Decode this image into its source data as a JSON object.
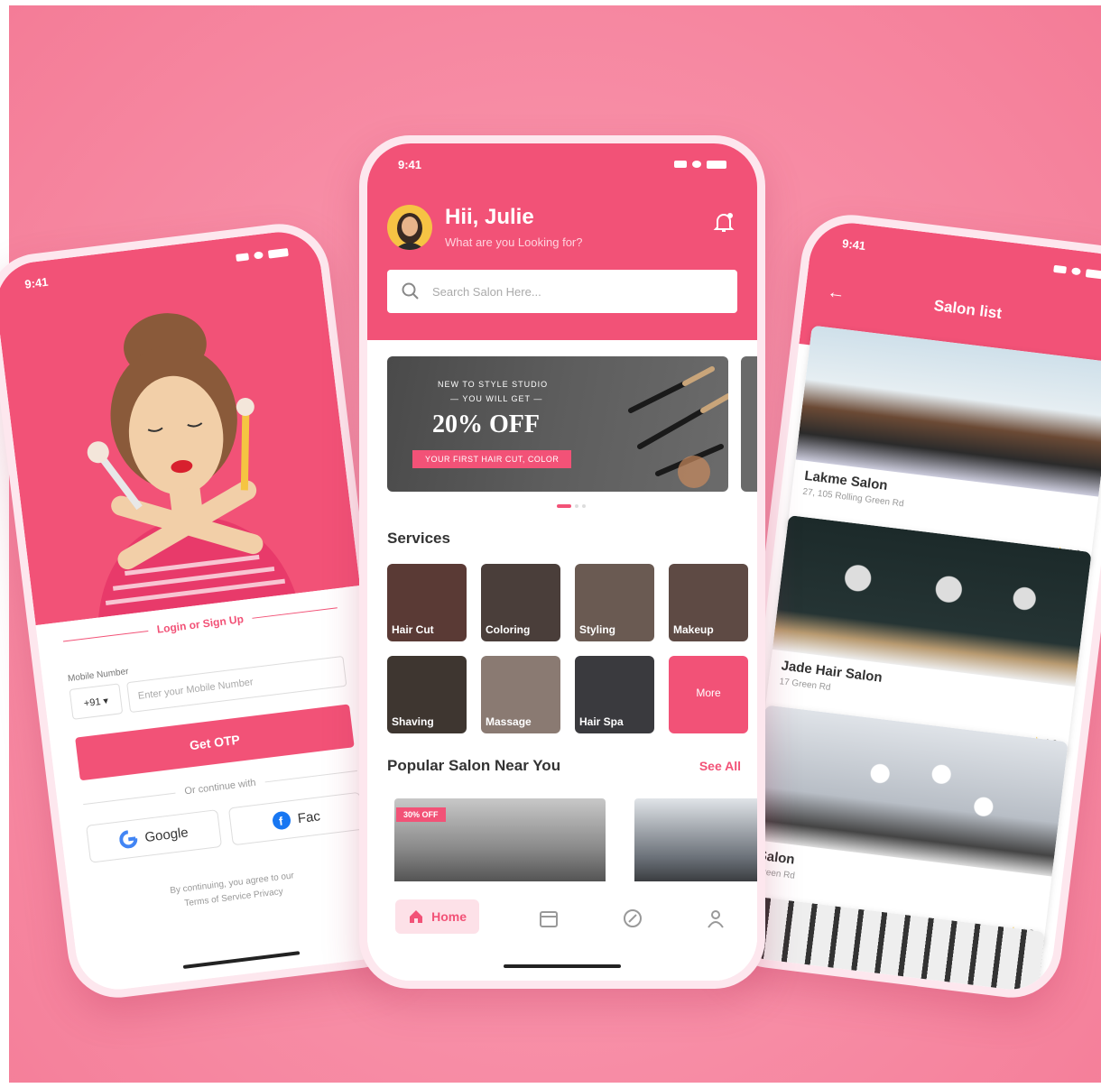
{
  "colors": {
    "accent": "#f25277",
    "background": "#f891a9"
  },
  "login": {
    "status_time": "9:41",
    "tab_label": "Login or Sign Up",
    "mobile_label": "Mobile Number",
    "country_code": "+91 ▾",
    "mobile_placeholder": "Enter your Mobile Number",
    "otp_button": "Get OTP",
    "continue_text": "Or continue with",
    "google_label": "Google",
    "facebook_label": "Fac",
    "terms_line1": "By continuing, you agree to our",
    "terms_line2": "Terms of Service   Privacy"
  },
  "home": {
    "status_time": "9:41",
    "greeting": "Hii, Julie",
    "subgreeting": "What are you Looking for?",
    "search_placeholder": "Search Salon Here...",
    "banner": {
      "line1": "NEW TO STYLE STUDIO",
      "line2": "— YOU WILL GET —",
      "headline": "20% OFF",
      "ribbon": "YOUR FIRST HAIR CUT, COLOR"
    },
    "services_title": "Services",
    "services": [
      {
        "label": "Hair Cut",
        "color": "#5a3a35"
      },
      {
        "label": "Coloring",
        "color": "#4a3e3a"
      },
      {
        "label": "Styling",
        "color": "#6a5a52"
      },
      {
        "label": "Makeup",
        "color": "#5e4a44"
      },
      {
        "label": "Shaving",
        "color": "#3e3630"
      },
      {
        "label": "Massage",
        "color": "#8a7a72"
      },
      {
        "label": "Hair Spa",
        "color": "#3a3a3e"
      }
    ],
    "more_label": "More",
    "popular_title": "Popular Salon Near You",
    "see_all": "See All",
    "offer_tag": "30% OFF",
    "nav_home": "Home"
  },
  "list": {
    "status_time": "9:41",
    "title": "Salon list",
    "back_icon": "←",
    "salons": [
      {
        "name": "Lakme Salon",
        "address": "27, 105 Rolling Green Rd",
        "rating": "4.2"
      },
      {
        "name": "Jade Hair Salon",
        "address": "17 Green Rd",
        "rating": "4.0"
      },
      {
        "name": "Salon",
        "address": "Green Rd",
        "rating": "4.2"
      }
    ]
  }
}
